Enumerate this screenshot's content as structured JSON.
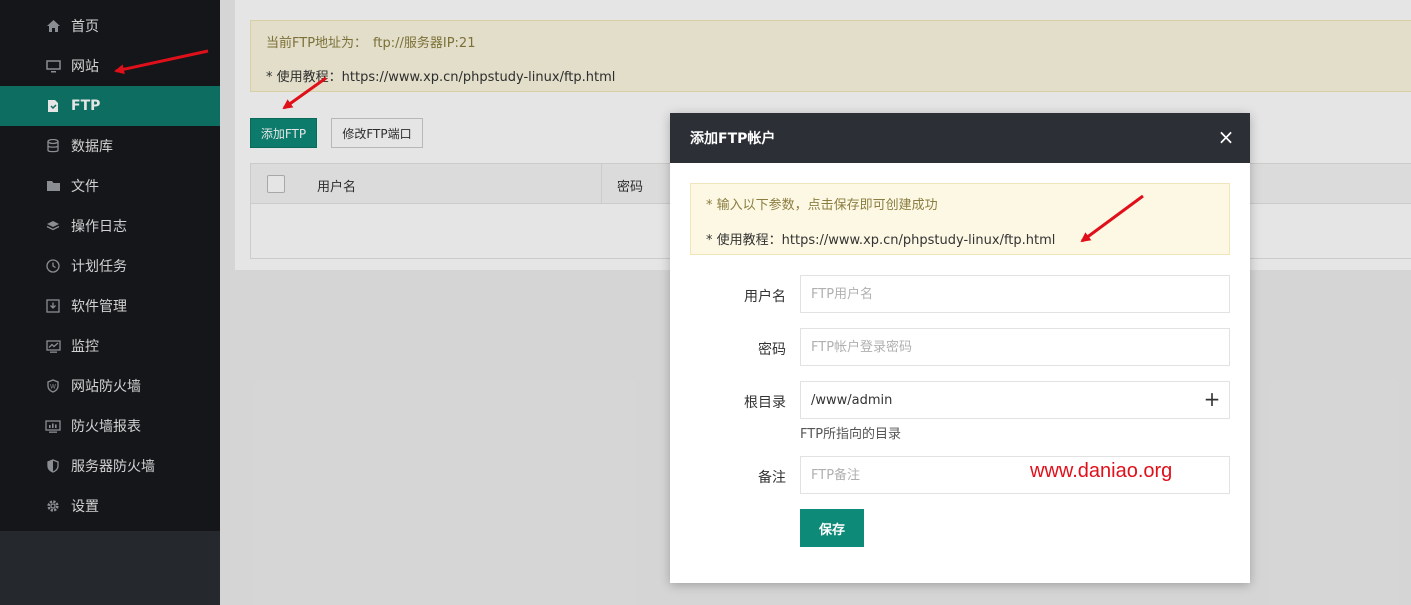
{
  "sidebar": {
    "items": [
      {
        "label": "首页",
        "icon": "home-icon",
        "active": false
      },
      {
        "label": "网站",
        "icon": "monitor-icon",
        "active": false
      },
      {
        "label": "FTP",
        "icon": "ftp-icon",
        "active": true
      },
      {
        "label": "数据库",
        "icon": "database-icon",
        "active": false
      },
      {
        "label": "文件",
        "icon": "folder-icon",
        "active": false
      },
      {
        "label": "操作日志",
        "icon": "layers-icon",
        "active": false
      },
      {
        "label": "计划任务",
        "icon": "clock-icon",
        "active": false
      },
      {
        "label": "软件管理",
        "icon": "download-icon",
        "active": false
      },
      {
        "label": "监控",
        "icon": "chart-icon",
        "active": false
      },
      {
        "label": "网站防火墙",
        "icon": "shield-icon",
        "active": false
      },
      {
        "label": "防火墙报表",
        "icon": "report-icon",
        "active": false
      },
      {
        "label": "服务器防火墙",
        "icon": "shield-half-icon",
        "active": false
      },
      {
        "label": "设置",
        "icon": "gear-icon",
        "active": false
      }
    ]
  },
  "main": {
    "notice_line1_prefix": "当前FTP地址为：",
    "notice_line1_addr": "ftp://服务器IP:21",
    "notice_line2": "* 使用教程：https://www.xp.cn/phpstudy-linux/ftp.html",
    "add_button": "添加FTP",
    "modify_port_button": "修改FTP端口",
    "table": {
      "headers": [
        "用户名",
        "密码"
      ]
    }
  },
  "modal": {
    "title": "添加FTP帐户",
    "close": "×",
    "notice_line1": "* 输入以下参数，点击保存即可创建成功",
    "notice_line2": "* 使用教程：https://www.xp.cn/phpstudy-linux/ftp.html",
    "fields": {
      "username": {
        "label": "用户名",
        "placeholder": "FTP用户名",
        "value": ""
      },
      "password": {
        "label": "密码",
        "placeholder": "FTP帐户登录密码",
        "value": ""
      },
      "root": {
        "label": "根目录",
        "value": "/www/admin",
        "hint": "FTP所指向的目录"
      },
      "remark": {
        "label": "备注",
        "placeholder": "FTP备注",
        "value": ""
      }
    },
    "plus": "+",
    "save": "保存",
    "watermark": "www.daniao.org"
  },
  "colors": {
    "accent": "#0e8a78",
    "sidebar_bg": "#17191c",
    "modal_header_bg": "#2c2f36",
    "annotation_red": "#e0101a"
  }
}
